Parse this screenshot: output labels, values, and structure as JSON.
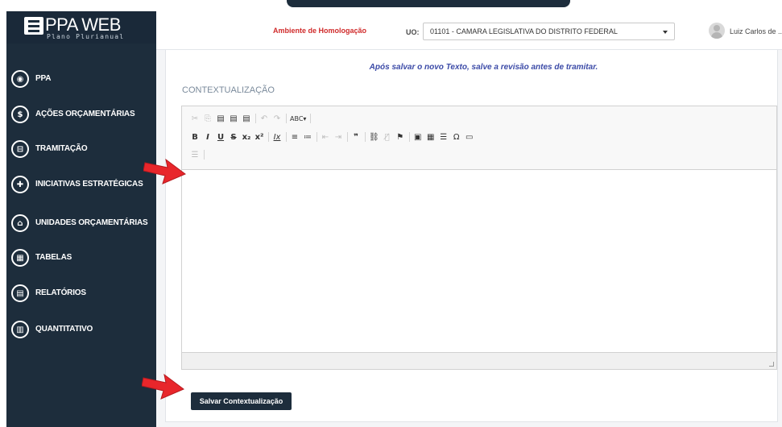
{
  "sidebar": {
    "logo": {
      "title": "PPA WEB",
      "subtitle": "Plano Plurianual"
    },
    "items": [
      {
        "label": "PPA",
        "icon": "database-icon",
        "glyph": "◉"
      },
      {
        "label": "AÇÕES ORÇAMENTÁRIAS",
        "icon": "dollar-icon",
        "glyph": "$"
      },
      {
        "label": "TRAMITAÇÃO",
        "icon": "inbox-icon",
        "glyph": "⊟"
      },
      {
        "label": "INICIATIVAS ESTRATÉGICAS",
        "icon": "puzzle-icon",
        "glyph": "✚"
      },
      {
        "label": "UNIDADES ORÇAMENTÁRIAS",
        "icon": "bank-icon",
        "glyph": "⌂"
      },
      {
        "label": "TABELAS",
        "icon": "table-icon",
        "glyph": "▦"
      },
      {
        "label": "RELATÓRIOS",
        "icon": "file-icon",
        "glyph": "▤"
      },
      {
        "label": "QUANTITATIVO",
        "icon": "bar-chart-icon",
        "glyph": "▥"
      }
    ]
  },
  "header": {
    "environment": "Ambiente de Homologação",
    "uo_label": "UO:",
    "uo_value": "01101 - CAMARA LEGISLATIVA DO DISTRITO FEDERAL",
    "user_name": "Luiz Carlos de ..."
  },
  "main": {
    "notice": "Após salvar o novo Texto, salve a revisão antes de tramitar.",
    "section_title": "CONTEXTUALIZAÇÃO",
    "editor": {
      "row1": [
        "✂",
        "⎘",
        "▤",
        "▤",
        "▤",
        "↶",
        "↷",
        "ABC▾"
      ],
      "row2": [
        "B",
        "I",
        "U",
        "S",
        "x₂",
        "x²",
        "Ix",
        "≡",
        "≔",
        "⇤",
        "⇥",
        "❞",
        "⛓",
        "⛓̸",
        "⚑",
        "▣",
        "▦",
        "☰",
        "Ω",
        "▭"
      ],
      "row3": [
        "☰"
      ],
      "content": ""
    },
    "save_label": "Salvar Contextualização"
  },
  "colors": {
    "sidebar_bg": "#1d2d3c",
    "environment_text": "#d02b2b",
    "notice_text": "#3b4aa7",
    "arrow": "#e8262b"
  }
}
